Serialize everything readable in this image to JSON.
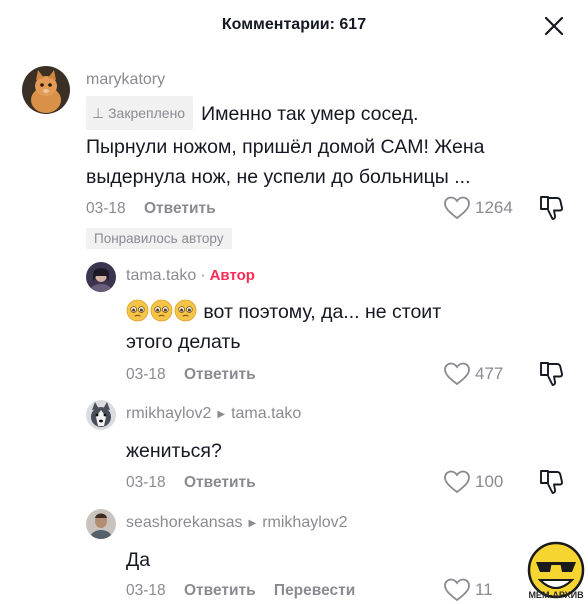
{
  "header": {
    "title": "Комментарии: 617"
  },
  "comments": [
    {
      "username": "marykatory",
      "pinned_label": "Закреплено",
      "text_lines": [
        "Именно так умер сосед.",
        "Пырнули ножом, пришёл домой САМ! Жена",
        "выдернула нож, не успели до больницы ..."
      ],
      "date": "03-18",
      "reply_label": "Ответить",
      "likes": "1264",
      "liked_by_author": "Понравилось автору"
    },
    {
      "username": "tama.tako",
      "author_badge": "Автор",
      "text_line1": "вот поэтому, да... не стоит",
      "text_line2": "этого делать",
      "date": "03-18",
      "reply_label": "Ответить",
      "likes": "477"
    },
    {
      "username": "rmikhaylov2",
      "reply_to": "tama.tako",
      "text": "жениться?",
      "date": "03-18",
      "reply_label": "Ответить",
      "likes": "100"
    },
    {
      "username": "seashorekansas",
      "reply_to": "rmikhaylov2",
      "text": "Да",
      "date": "03-18",
      "reply_label": "Ответить",
      "translate_label": "Перевести",
      "likes": "11"
    }
  ],
  "watermark": {
    "text": "МЕМ-АРХИВ"
  },
  "colors": {
    "accent": "#fe2c55",
    "muted": "#8a8b91",
    "text": "#161823"
  }
}
